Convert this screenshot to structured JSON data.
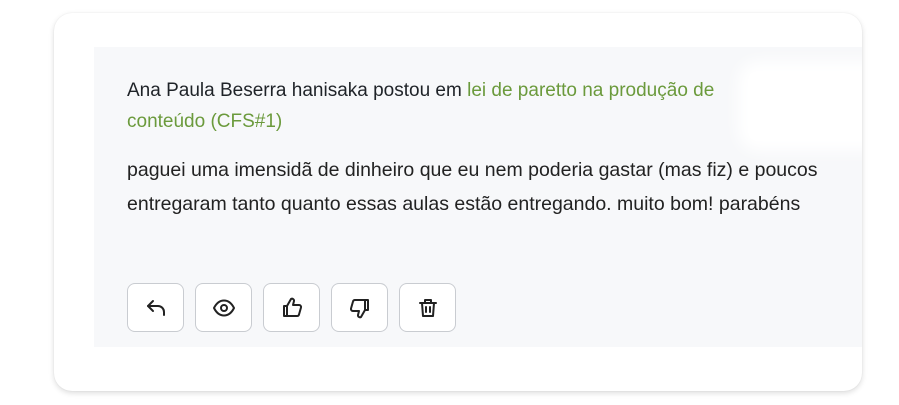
{
  "post": {
    "author_line": "Ana Paula Beserra hanisaka postou em",
    "topic_link": "lei de paretto na produção de conteúdo (CFS#1)",
    "body": "paguei uma imensidã de dinheiro que eu nem poderia gastar (mas fiz) e poucos entregaram tanto quanto essas aulas estão entregando. muito bom! parabéns"
  },
  "actions": [
    {
      "icon": "reply-icon"
    },
    {
      "icon": "eye-icon"
    },
    {
      "icon": "thumbs-up-icon"
    },
    {
      "icon": "thumbs-down-icon"
    },
    {
      "icon": "trash-icon"
    }
  ],
  "colors": {
    "link": "#6b9a3c",
    "text": "#222222",
    "panel": "#f7f8fa",
    "button_border": "#c9ccd1"
  }
}
